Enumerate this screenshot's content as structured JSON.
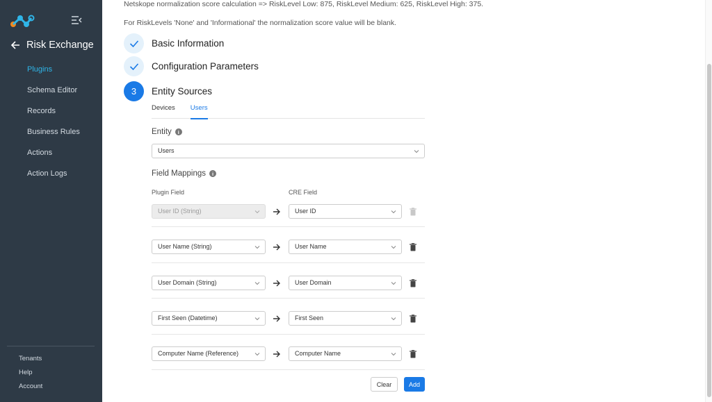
{
  "sidebar": {
    "title": "Risk Exchange",
    "nav": [
      "Plugins",
      "Schema Editor",
      "Records",
      "Business Rules",
      "Actions",
      "Action Logs"
    ],
    "bottom_nav": [
      "Tenants",
      "Help",
      "Account"
    ],
    "active_color": "#2fb5e8"
  },
  "main": {
    "info_lines": [
      "Netskope normalization score calculation => RiskLevel Low: 875, RiskLevel Medium: 625, RiskLevel High: 375.",
      "For RiskLevels 'None' and 'Informational' the normalization score value will be blank."
    ],
    "steps": [
      {
        "number": "",
        "title": "Basic Information",
        "status": "done"
      },
      {
        "number": "",
        "title": "Configuration Parameters",
        "status": "done"
      },
      {
        "number": "3",
        "title": "Entity Sources",
        "status": "current"
      }
    ],
    "tabs": [
      {
        "label": "Devices",
        "active": false
      },
      {
        "label": "Users",
        "active": true
      }
    ],
    "entity": {
      "label": "Entity",
      "value": "Users"
    },
    "field_mappings": {
      "label": "Field Mappings",
      "plugin_field_header": "Plugin Field",
      "cre_field_header": "CRE Field",
      "rows": [
        {
          "plugin": "User ID (String)",
          "cre": "User ID",
          "locked": true
        },
        {
          "plugin": "User Name (String)",
          "cre": "User Name",
          "locked": false
        },
        {
          "plugin": "User Domain (String)",
          "cre": "User Domain",
          "locked": false
        },
        {
          "plugin": "First Seen (Datetime)",
          "cre": "First Seen",
          "locked": false
        },
        {
          "plugin": "Computer Name (Reference)",
          "cre": "Computer Name",
          "locked": false
        }
      ]
    },
    "buttons": {
      "clear": "Clear",
      "add": "Add"
    },
    "accent": "#1a7ae6"
  }
}
